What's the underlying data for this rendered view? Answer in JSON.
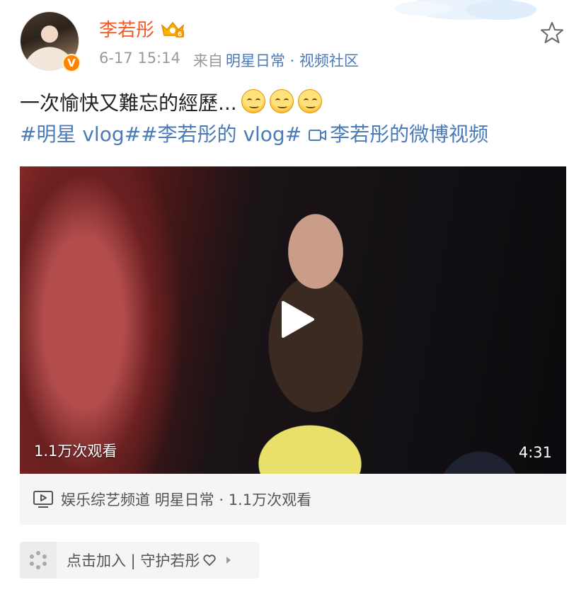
{
  "post": {
    "username": "李若彤",
    "time": "6-17 15:14",
    "source_prefix": "来自",
    "source": "明星日常 · 视频社区",
    "text": "一次愉快又難忘的經歷...",
    "topics": "#明星 vlog##李若彤的 vlog#",
    "video_link": "李若彤的微博视频"
  },
  "video": {
    "views": "1.1万次观看",
    "duration": "4:31"
  },
  "channel": {
    "text": "娱乐综艺频道 明星日常 · 1.1万次观看"
  },
  "join": {
    "label": "点击加入 | 守护若彤"
  },
  "colors": {
    "username": "#f15a24",
    "link": "#4a7ab8",
    "badge": "#ff8200"
  },
  "icons": [
    "crown-icon",
    "verified-badge-icon",
    "star-icon",
    "emoji-smile-icon",
    "video-link-icon",
    "play-icon",
    "tv-icon",
    "spinner-icon",
    "heart-icon",
    "arrow-right-icon"
  ]
}
